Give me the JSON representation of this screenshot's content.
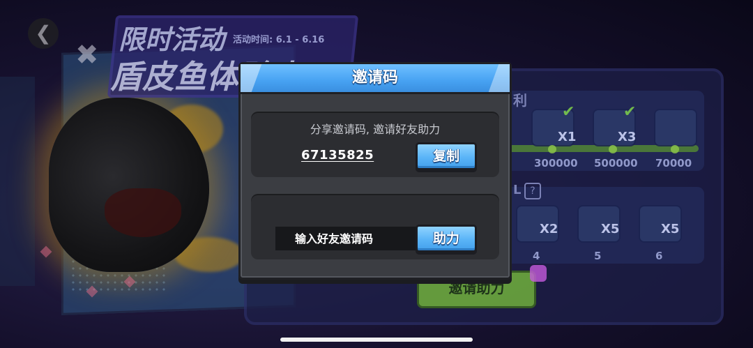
{
  "background": {
    "back_glyph": "❮",
    "close_glyph": "✖",
    "event_title": "限时活动",
    "event_subtitle": "盾皮鱼体验卡",
    "event_time": "活动时间: 6.1 - 6.16",
    "section1_label": "利",
    "section2_label": "L",
    "rewards_row1": [
      {
        "qty": "X1",
        "checked": true,
        "points": "300000"
      },
      {
        "qty": "X3",
        "checked": true,
        "points": "500000"
      },
      {
        "qty": "",
        "checked": false,
        "points": "70000"
      }
    ],
    "rewards_row2": [
      {
        "qty": "X2",
        "step": "4"
      },
      {
        "qty": "X5",
        "step": "5"
      },
      {
        "qty": "X5",
        "step": "6"
      }
    ],
    "invite_button_label": "邀请助力",
    "check_glyph": "✔",
    "question_glyph": "?"
  },
  "modal": {
    "title": "邀请码",
    "share_caption": "分享邀请码, 邀请好友助力",
    "invite_code": "67135825",
    "copy_label": "复制",
    "friend_code_placeholder": "输入好友邀请码",
    "assist_label": "助力"
  },
  "colors": {
    "accent_blue": "#47a2f2",
    "modal_bg": "#3b3d42",
    "section_bg": "#2c2d31"
  }
}
